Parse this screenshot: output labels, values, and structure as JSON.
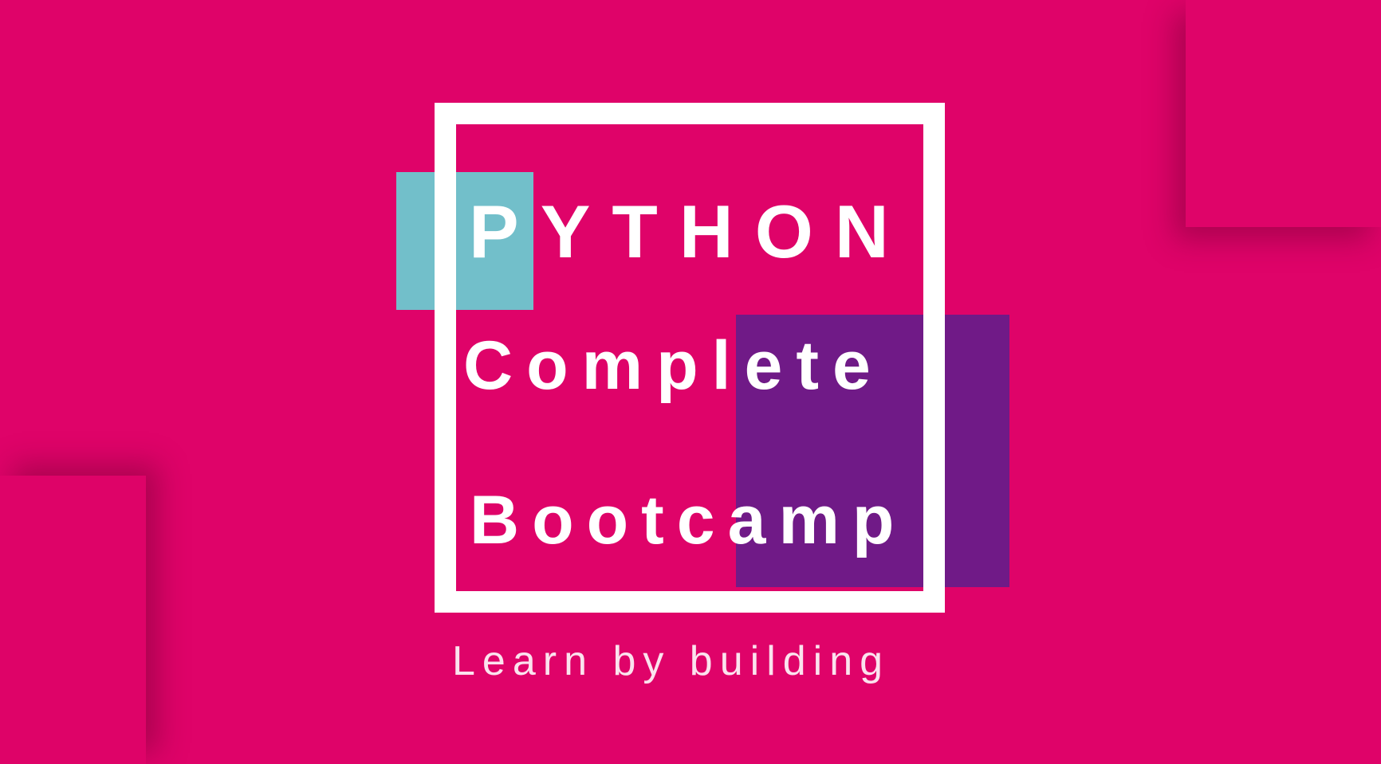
{
  "title": {
    "line1": "PYTHON",
    "line2": "Complete",
    "line3": "Bootcamp"
  },
  "tagline": "Learn by building",
  "colors": {
    "background": "#df0369",
    "frame": "#ffffff",
    "accent_teal": "#72bfca",
    "accent_purple": "#701a87",
    "text": "#ffffff"
  }
}
